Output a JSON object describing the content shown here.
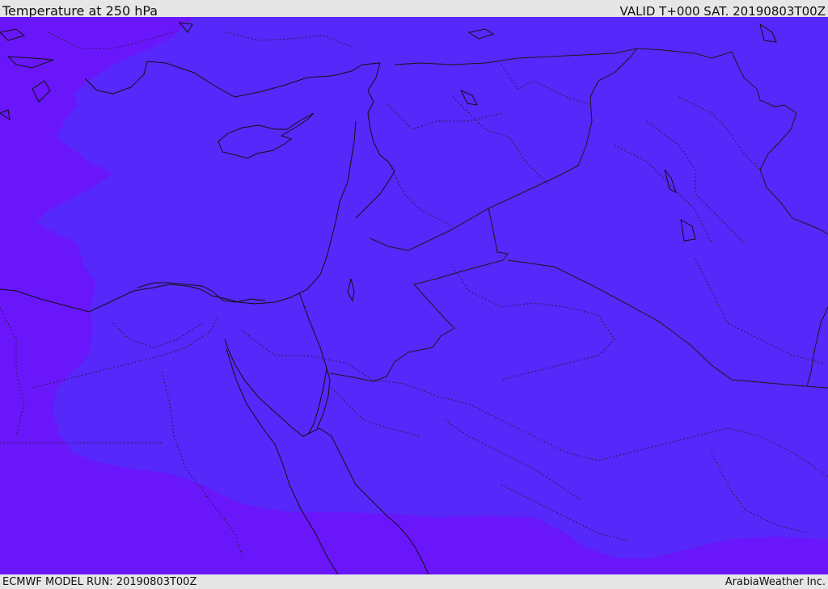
{
  "header": {
    "title": "Temperature at 250 hPa",
    "valid": "VALID T+000 SAT. 20190803T00Z"
  },
  "footer": {
    "model_run": "ECMWF MODEL RUN: 20190803T00Z",
    "credit": "ArabiaWeather Inc."
  },
  "map": {
    "colors": {
      "outer_band": "#6a16fb",
      "inner_band": "#5628f9",
      "coastline": "#111111",
      "border": "#1a1a1a"
    }
  }
}
